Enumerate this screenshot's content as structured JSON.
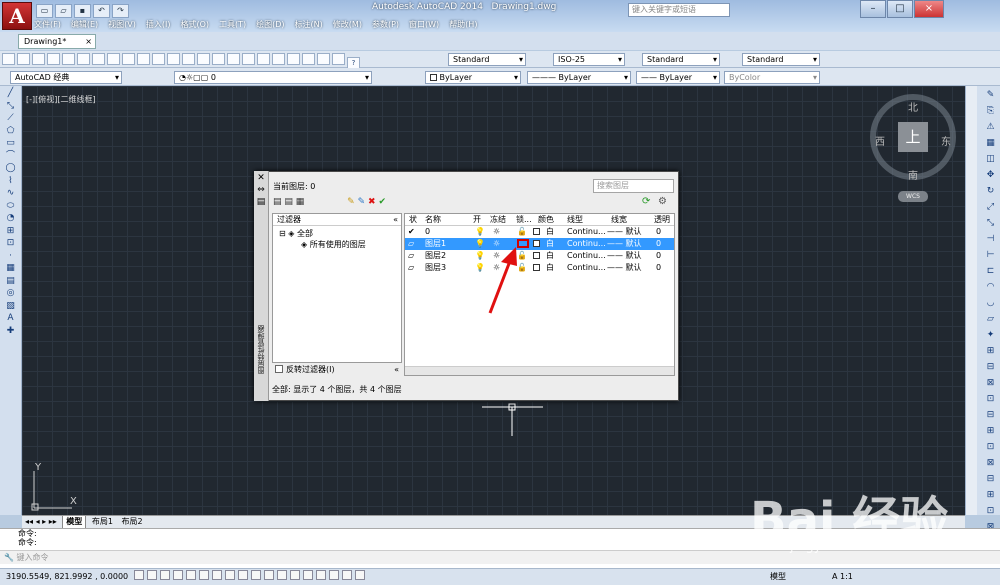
{
  "app": {
    "title": "Autodesk AutoCAD 2014",
    "file": "Drawing1.dwg",
    "search_placeholder": "键入关键字或短语"
  },
  "menu": [
    "文件(F)",
    "编辑(E)",
    "视图(V)",
    "插入(I)",
    "格式(O)",
    "工具(T)",
    "绘图(D)",
    "标注(N)",
    "修改(M)",
    "参数(P)",
    "窗口(W)",
    "帮助(H)"
  ],
  "tabs": {
    "doc": "Drawing1*"
  },
  "toolbar": {
    "text_style": "Standard",
    "dim_style": "ISO-25",
    "table_style": "Standard",
    "mleader_style": "Standard",
    "workspace": "AutoCAD 经典",
    "layer_current": "0",
    "color": "ByLayer",
    "linetype": "ByLayer",
    "lineweight": "ByLayer",
    "plotstyle": "ByColor"
  },
  "viewport": {
    "label": "[-][俯视][二维线框]"
  },
  "viewcube": {
    "north": "北",
    "south": "南",
    "east": "东",
    "west": "西",
    "face": "上",
    "wcs": "WCS"
  },
  "dialog": {
    "side_label": "图层特性管理器",
    "current_layer": "当前图层: 0",
    "search_placeholder": "搜索图层",
    "filter_header": "过滤器",
    "tree_all": "全部",
    "tree_used": "所有使用的图层",
    "invert_filter": "反转过滤器(I)",
    "columns": [
      "状",
      "名称",
      "开",
      "冻结",
      "锁...",
      "颜色",
      "线型",
      "线宽",
      "透明"
    ],
    "rows": [
      {
        "name": "0",
        "color": "白",
        "linetype": "Continu...",
        "lineweight": "默认",
        "transparency": "0"
      },
      {
        "name": "图层1",
        "color": "白",
        "linetype": "Continu...",
        "lineweight": "默认",
        "transparency": "0"
      },
      {
        "name": "图层2",
        "color": "白",
        "linetype": "Continu...",
        "lineweight": "默认",
        "transparency": "0"
      },
      {
        "name": "图层3",
        "color": "白",
        "linetype": "Continu...",
        "lineweight": "默认",
        "transparency": "0"
      }
    ],
    "status": "全部: 显示了 4 个图层，共 4 个图层"
  },
  "layout_tabs": [
    "模型",
    "布局1",
    "布局2"
  ],
  "command": {
    "line1": "命令:",
    "line2": "命令:",
    "prompt": "键入命令"
  },
  "statusbar": {
    "coords": "3190.5549, 821.9992 , 0.0000",
    "model": "模型",
    "scale": "A 1:1"
  },
  "watermark": {
    "brand": "Bai 经验",
    "url": "jingyan.baidu.com"
  }
}
